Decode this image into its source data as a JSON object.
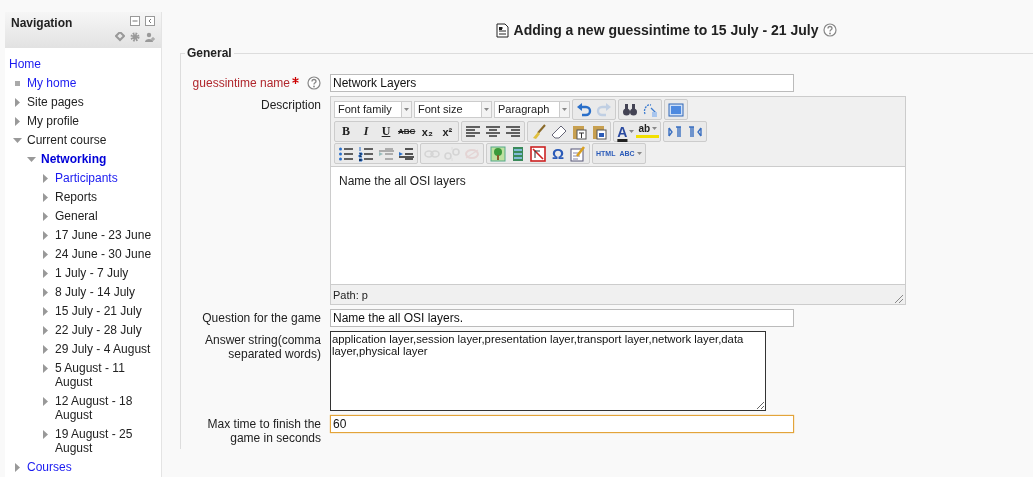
{
  "navigation": {
    "title": "Navigation",
    "items": [
      {
        "label": "Home",
        "kind": "root",
        "link": true
      },
      {
        "label": "My home",
        "kind": "leaf",
        "link": true
      },
      {
        "label": "Site pages",
        "kind": "branch",
        "link": false,
        "expanded": false
      },
      {
        "label": "My profile",
        "kind": "branch",
        "link": false,
        "expanded": false
      },
      {
        "label": "Current course",
        "kind": "branch",
        "link": false,
        "expanded": true,
        "children": [
          {
            "label": "Networking",
            "kind": "branch",
            "link": true,
            "current": true,
            "expanded": true,
            "children": [
              {
                "label": "Participants",
                "kind": "branch",
                "link": true,
                "expanded": false
              },
              {
                "label": "Reports",
                "kind": "branch",
                "link": false,
                "expanded": false
              },
              {
                "label": "General",
                "kind": "branch",
                "link": false,
                "expanded": false
              },
              {
                "label": "17 June - 23 June",
                "kind": "branch",
                "link": false,
                "expanded": false
              },
              {
                "label": "24 June - 30 June",
                "kind": "branch",
                "link": false,
                "expanded": false
              },
              {
                "label": "1 July - 7 July",
                "kind": "branch",
                "link": false,
                "expanded": false
              },
              {
                "label": "8 July - 14 July",
                "kind": "branch",
                "link": false,
                "expanded": false
              },
              {
                "label": "15 July - 21 July",
                "kind": "branch",
                "link": false,
                "expanded": false
              },
              {
                "label": "22 July - 28 July",
                "kind": "branch",
                "link": false,
                "expanded": false
              },
              {
                "label": "29 July - 4 August",
                "kind": "branch",
                "link": false,
                "expanded": false
              },
              {
                "label": "5 August - 11 August",
                "kind": "branch",
                "link": false,
                "expanded": false
              },
              {
                "label": "12 August - 18 August",
                "kind": "branch",
                "link": false,
                "expanded": false
              },
              {
                "label": "19 August - 25 August",
                "kind": "branch",
                "link": false,
                "expanded": false
              }
            ]
          }
        ]
      },
      {
        "label": "Courses",
        "kind": "branch",
        "link": true,
        "expanded": false
      }
    ]
  },
  "page_title": "Adding a new guessintime to 15 July - 21 July",
  "fieldset": {
    "legend": "General",
    "fields": [
      {
        "kind": "text",
        "label": "guessintime name",
        "required": true,
        "help": true,
        "value": "Network Layers",
        "focused": false
      },
      {
        "kind": "editor",
        "label": "Description",
        "value": "Name the all OSI layers",
        "path": "Path: p"
      },
      {
        "kind": "text",
        "label": "Question for the game",
        "required": false,
        "help": false,
        "value": "Name the all OSI layers.",
        "focused": false
      },
      {
        "kind": "textarea",
        "label": "Answer string(comma separated words)",
        "value": "application layer,session layer,presentation layer,transport layer,network layer,data layer,physical layer"
      },
      {
        "kind": "text",
        "label": "Max time to finish the game in seconds",
        "required": false,
        "help": false,
        "value": "60",
        "focused": true
      }
    ]
  },
  "toolbar": [
    [
      {
        "kind": "select",
        "label": "Font family"
      },
      {
        "kind": "select",
        "label": "Font size"
      },
      {
        "kind": "select",
        "label": "Paragraph"
      },
      {
        "kind": "group",
        "buttons": [
          {
            "kind": "undo",
            "disabled": false
          },
          {
            "kind": "redo",
            "disabled": true
          }
        ]
      },
      {
        "kind": "group",
        "buttons": [
          {
            "kind": "find",
            "disabled": false
          },
          {
            "kind": "replace",
            "disabled": false
          }
        ]
      },
      {
        "kind": "group",
        "buttons": [
          {
            "kind": "fullscreen",
            "disabled": false
          }
        ]
      }
    ],
    [
      {
        "kind": "group",
        "buttons": [
          {
            "kind": "bold",
            "glyph": "B",
            "disabled": false
          },
          {
            "kind": "italic",
            "glyph": "I",
            "disabled": false
          },
          {
            "kind": "underline",
            "glyph": "U",
            "disabled": false
          },
          {
            "kind": "strike",
            "glyph": "ABC",
            "disabled": false
          },
          {
            "kind": "sub",
            "glyph": "x₂",
            "disabled": false
          },
          {
            "kind": "sup",
            "glyph": "x²",
            "disabled": false
          }
        ]
      },
      {
        "kind": "group",
        "buttons": [
          {
            "kind": "align-left",
            "disabled": false
          },
          {
            "kind": "align-center",
            "disabled": false
          },
          {
            "kind": "align-right",
            "disabled": false
          }
        ]
      },
      {
        "kind": "group",
        "buttons": [
          {
            "kind": "brush",
            "disabled": false
          },
          {
            "kind": "eraser",
            "disabled": false
          },
          {
            "kind": "paste-text",
            "disabled": false
          },
          {
            "kind": "paste-word",
            "disabled": false
          }
        ]
      },
      {
        "kind": "group",
        "buttons": [
          {
            "kind": "text-color",
            "glyph": "A",
            "disabled": false
          },
          {
            "kind": "highlight",
            "glyph": "ab",
            "disabled": false
          }
        ]
      },
      {
        "kind": "group",
        "buttons": [
          {
            "kind": "ltr",
            "disabled": false
          },
          {
            "kind": "rtl",
            "disabled": false
          }
        ]
      }
    ],
    [
      {
        "kind": "group",
        "buttons": [
          {
            "kind": "bullets",
            "disabled": false
          },
          {
            "kind": "numbers",
            "disabled": false
          },
          {
            "kind": "outdent",
            "disabled": false
          },
          {
            "kind": "indent",
            "disabled": false
          }
        ]
      },
      {
        "kind": "group",
        "buttons": [
          {
            "kind": "link",
            "disabled": true
          },
          {
            "kind": "unlink",
            "disabled": true
          },
          {
            "kind": "anchor",
            "disabled": true
          }
        ]
      },
      {
        "kind": "group",
        "buttons": [
          {
            "kind": "image",
            "disabled": false
          },
          {
            "kind": "media",
            "disabled": false
          },
          {
            "kind": "nolink",
            "disabled": false
          },
          {
            "kind": "omega",
            "glyph": "Ω",
            "disabled": false
          },
          {
            "kind": "edit",
            "disabled": false
          }
        ]
      },
      {
        "kind": "group",
        "buttons": [
          {
            "kind": "html",
            "glyph": "HTML",
            "disabled": false
          },
          {
            "kind": "spell",
            "glyph": "ABC",
            "disabled": false
          }
        ]
      }
    ]
  ]
}
